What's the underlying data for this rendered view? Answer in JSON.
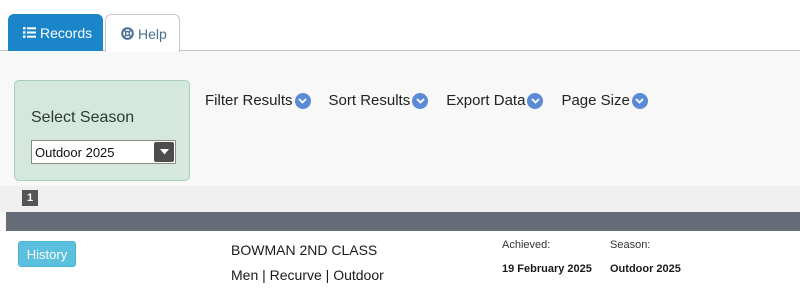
{
  "tabs": {
    "records": {
      "label": "Records",
      "icon": "list-icon"
    },
    "help": {
      "label": "Help",
      "icon": "lifebuoy-icon"
    }
  },
  "season": {
    "title": "Select Season",
    "selected": "Outdoor 2025"
  },
  "menu": {
    "filter": "Filter Results",
    "sort": "Sort Results",
    "export": "Export Data",
    "page_size": "Page Size"
  },
  "pagination": {
    "current": "1"
  },
  "record": {
    "history_label": "History",
    "title": "BOWMAN 2ND CLASS",
    "subtitle": "Men | Recurve | Outdoor",
    "achieved_label": "Achieved:",
    "achieved_value": "19 February 2025",
    "season_label": "Season:",
    "season_value": "Outdoor 2025"
  },
  "colors": {
    "primary": "#1a85c9",
    "season_box": "#d4e8dd",
    "chevron": "#5b8ad6",
    "history": "#5bc0de",
    "divider": "#666b78"
  }
}
